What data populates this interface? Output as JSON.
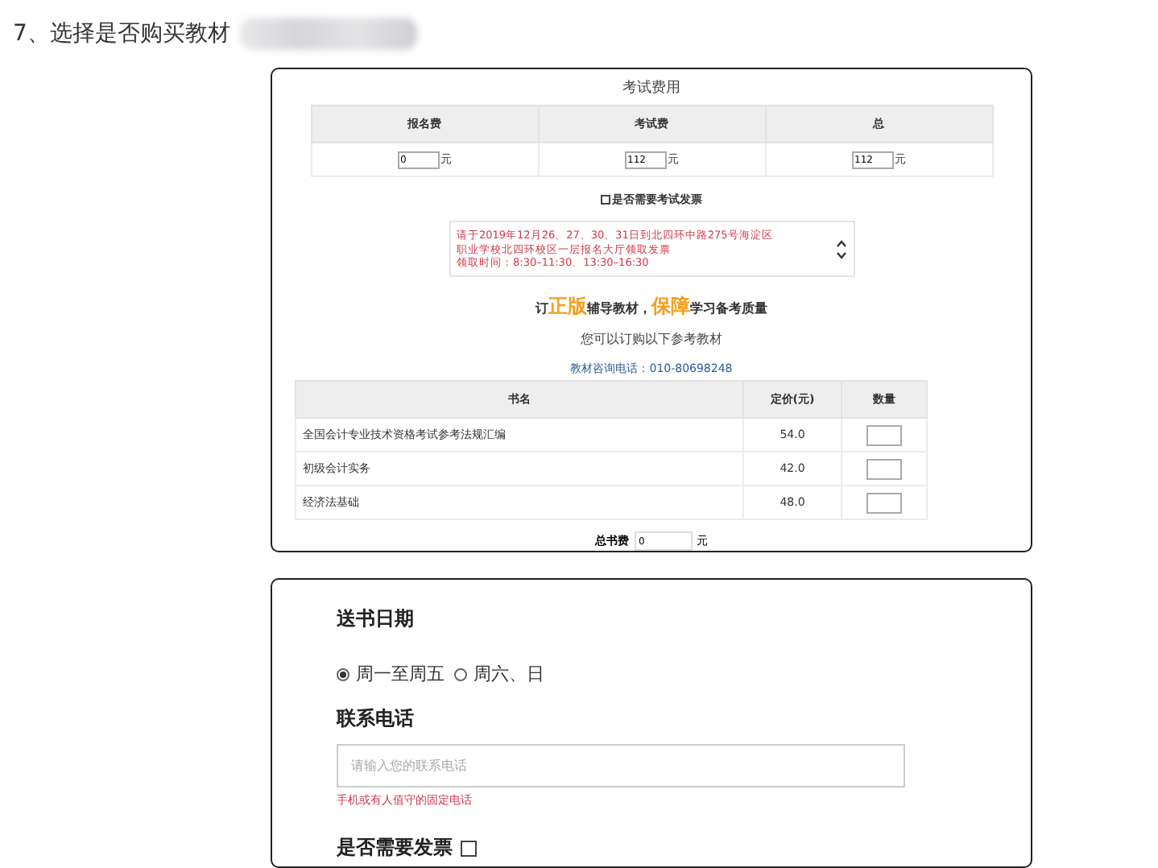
{
  "heading": "7、选择是否购买教材",
  "fees": {
    "title": "考试费用",
    "columns": [
      "报名费",
      "考试费",
      "总"
    ],
    "values": [
      {
        "value": "0",
        "unit": "元"
      },
      {
        "value": "112",
        "unit": "元"
      },
      {
        "value": "112",
        "unit": "元"
      }
    ],
    "invoice_option": {
      "label": "是否需要考试发票",
      "checked": false
    }
  },
  "notice": [
    "请于2019年12月26、27、30、31日到北四环中路275号海淀区",
    "职业学校北四环校区一层报名大厅领取发票",
    "领取时间：8:30–11:30、13:30–16:30"
  ],
  "banner": "订**正版**辅导教材，**保障**学习备考质量",
  "subtitle": "您可以订购以下参考教材",
  "phone_link": "教材咨询电话：010-80698248",
  "books": {
    "columns": [
      "书名",
      "定价(元)",
      "数量"
    ],
    "rows": [
      {
        "name": "全国会计专业技术资格考试参考法规汇编",
        "price": "54.0"
      },
      {
        "name": "初级会计实务",
        "price": "42.0"
      },
      {
        "name": "经济法基础",
        "price": "48.0"
      }
    ],
    "total_label": "总书费",
    "total_value": "0",
    "total_unit": "元"
  },
  "delivery": {
    "title": "送书日期",
    "options": [
      {
        "label": "周一至周五",
        "selected": true
      },
      {
        "label": "周六、日",
        "selected": false
      }
    ]
  },
  "contact": {
    "title": "联系电话",
    "placeholder": "请输入您的联系电话",
    "hint": "手机或有人值守的固定电话"
  },
  "invoice": {
    "label": "是否需要发票",
    "checked": false
  }
}
